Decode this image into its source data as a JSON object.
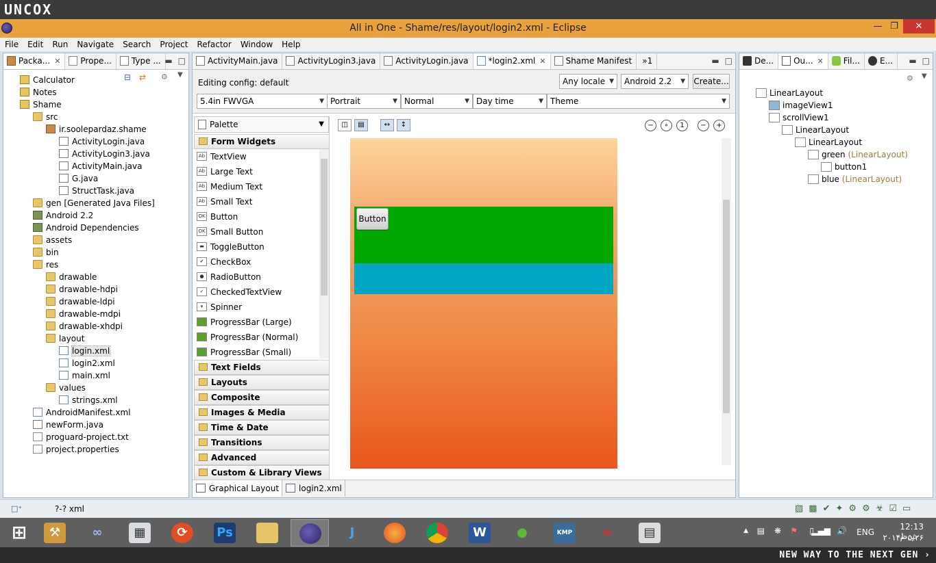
{
  "brand": "UNCOX",
  "footer_tagline": "NEW WAY TO THE NEXT GEN ›",
  "window": {
    "title": "All in One - Shame/res/layout/login2.xml - Eclipse"
  },
  "menu": [
    "File",
    "Edit",
    "Run",
    "Navigate",
    "Search",
    "Project",
    "Refactor",
    "Window",
    "Help"
  ],
  "left_tabs": [
    "Packa...",
    "Prope...",
    "Type ..."
  ],
  "package_tree": [
    {
      "label": "Calculator",
      "icon": "project-icon",
      "depth": 0
    },
    {
      "label": "Notes",
      "icon": "project-icon",
      "depth": 0
    },
    {
      "label": "Shame",
      "icon": "project-icon",
      "depth": 0
    },
    {
      "label": "src",
      "icon": "folder-icon",
      "depth": 1
    },
    {
      "label": "ir.soolepardaz.shame",
      "icon": "package-icon",
      "depth": 2
    },
    {
      "label": "ActivityLogin.java",
      "icon": "java-file-icon",
      "depth": 3
    },
    {
      "label": "ActivityLogin3.java",
      "icon": "java-file-icon",
      "depth": 3
    },
    {
      "label": "ActivityMain.java",
      "icon": "java-file-icon",
      "depth": 3
    },
    {
      "label": "G.java",
      "icon": "java-file-icon",
      "depth": 3
    },
    {
      "label": "StructTask.java",
      "icon": "java-file-icon",
      "depth": 3
    },
    {
      "label": "gen [Generated Java Files]",
      "icon": "folder-icon",
      "depth": 1
    },
    {
      "label": "Android 2.2",
      "icon": "library-icon",
      "depth": 1
    },
    {
      "label": "Android Dependencies",
      "icon": "library-icon",
      "depth": 1
    },
    {
      "label": "assets",
      "icon": "folder-icon",
      "depth": 1
    },
    {
      "label": "bin",
      "icon": "folder-icon",
      "depth": 1
    },
    {
      "label": "res",
      "icon": "folder-icon",
      "depth": 1
    },
    {
      "label": "drawable",
      "icon": "folder-icon",
      "depth": 2
    },
    {
      "label": "drawable-hdpi",
      "icon": "folder-icon",
      "depth": 2
    },
    {
      "label": "drawable-ldpi",
      "icon": "folder-icon",
      "depth": 2
    },
    {
      "label": "drawable-mdpi",
      "icon": "folder-icon",
      "depth": 2
    },
    {
      "label": "drawable-xhdpi",
      "icon": "folder-icon",
      "depth": 2
    },
    {
      "label": "layout",
      "icon": "folder-icon",
      "depth": 2
    },
    {
      "label": "login.xml",
      "icon": "xml-file-icon",
      "depth": 3
    },
    {
      "label": "login2.xml",
      "icon": "xml-file-icon",
      "depth": 3
    },
    {
      "label": "main.xml",
      "icon": "xml-file-icon",
      "depth": 3
    },
    {
      "label": "values",
      "icon": "folder-icon",
      "depth": 2
    },
    {
      "label": "strings.xml",
      "icon": "xml-file-icon",
      "depth": 3
    },
    {
      "label": "AndroidManifest.xml",
      "icon": "xml-file-icon",
      "depth": 1
    },
    {
      "label": "newForm.java",
      "icon": "java-file-icon",
      "depth": 1
    },
    {
      "label": "proguard-project.txt",
      "icon": "file-icon",
      "depth": 1
    },
    {
      "label": "project.properties",
      "icon": "file-icon",
      "depth": 1
    }
  ],
  "editor_tabs": [
    "ActivityMain.java",
    "ActivityLogin3.java",
    "ActivityLogin.java",
    "*login2.xml",
    "Shame Manifest",
    "»1"
  ],
  "config": {
    "editing_label": "Editing config:  default",
    "locale": "Any locale",
    "api": "Android 2.2",
    "create": "Create...",
    "device": "5.4in FWVGA",
    "orientation": "Portrait",
    "mode": "Normal",
    "time": "Day time",
    "theme": "Theme"
  },
  "palette": {
    "header": "Palette",
    "open_category": "Form Widgets",
    "items": [
      "TextView",
      "Large Text",
      "Medium Text",
      "Small Text",
      "Button",
      "Small Button",
      "ToggleButton",
      "CheckBox",
      "RadioButton",
      "CheckedTextView",
      "Spinner",
      "ProgressBar (Large)",
      "ProgressBar (Normal)",
      "ProgressBar (Small)"
    ],
    "categories": [
      "Text Fields",
      "Layouts",
      "Composite",
      "Images & Media",
      "Time & Date",
      "Transitions",
      "Advanced",
      "Custom & Library Views"
    ]
  },
  "canvas": {
    "button_label": "Button"
  },
  "bottom_tabs": [
    "Graphical Layout",
    "login2.xml"
  ],
  "right_tabs": [
    "De...",
    "Ou...",
    "Fil...",
    "E..."
  ],
  "outline": [
    {
      "name": "LinearLayout",
      "type": "",
      "depth": 0
    },
    {
      "name": "imageView1",
      "type": "",
      "depth": 1
    },
    {
      "name": "scrollView1",
      "type": "",
      "depth": 1
    },
    {
      "name": "LinearLayout",
      "type": "",
      "depth": 2
    },
    {
      "name": "LinearLayout",
      "type": "",
      "depth": 3
    },
    {
      "name": "green",
      "type": "(LinearLayout)",
      "depth": 4
    },
    {
      "name": "button1",
      "type": "",
      "depth": 5
    },
    {
      "name": "blue",
      "type": "(LinearLayout)",
      "depth": 4
    }
  ],
  "status": {
    "left": "?-? xml"
  },
  "tray": {
    "lang": "ENG",
    "time": "12:13 ب.ظ",
    "date": "۲۰۱۴/۰۵/۲۶"
  },
  "taskbar_apps": [
    "Ps",
    "W"
  ]
}
